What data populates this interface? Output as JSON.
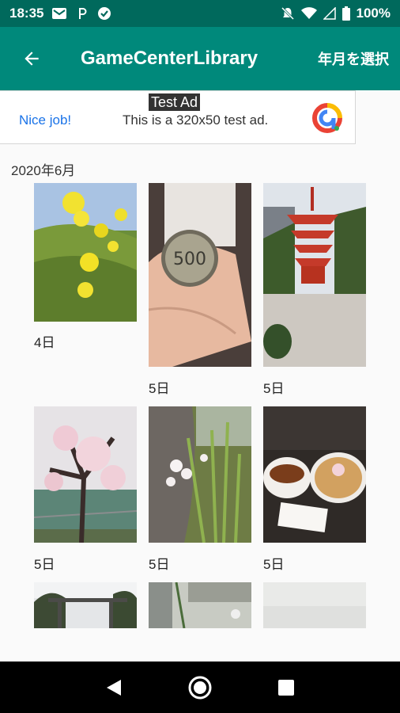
{
  "status": {
    "time": "18:35",
    "battery": "100%",
    "left_icons": [
      "gmail-icon",
      "p-icon",
      "check-badge-icon"
    ],
    "right_icons": [
      "bell-off-icon",
      "wifi-icon",
      "signal-icon",
      "battery-icon"
    ]
  },
  "appbar": {
    "title": "GameCenterLibrary",
    "select_label": "年月を選択",
    "back_icon": "arrow-back-icon"
  },
  "ad": {
    "badge": "Test Ad",
    "nice": "Nice job!",
    "text": "This is a 320x50 test ad."
  },
  "gallery": {
    "section_title": "2020年6月",
    "photos": [
      {
        "day": "4日",
        "subject": "yellow-flowers"
      },
      {
        "day": "5日",
        "subject": "coin-500-yen"
      },
      {
        "day": "5日",
        "subject": "pagoda"
      },
      {
        "day": "5日",
        "subject": "cherry-blossom"
      },
      {
        "day": "5日",
        "subject": "tree-white-flowers"
      },
      {
        "day": "5日",
        "subject": "ramen-curry"
      },
      {
        "day": "",
        "subject": "torii-gate"
      },
      {
        "day": "",
        "subject": "street-fence"
      },
      {
        "day": "",
        "subject": "room"
      }
    ]
  },
  "colors": {
    "status_bar": "#00695c",
    "app_bar": "#00897b",
    "background": "#fafafa"
  }
}
